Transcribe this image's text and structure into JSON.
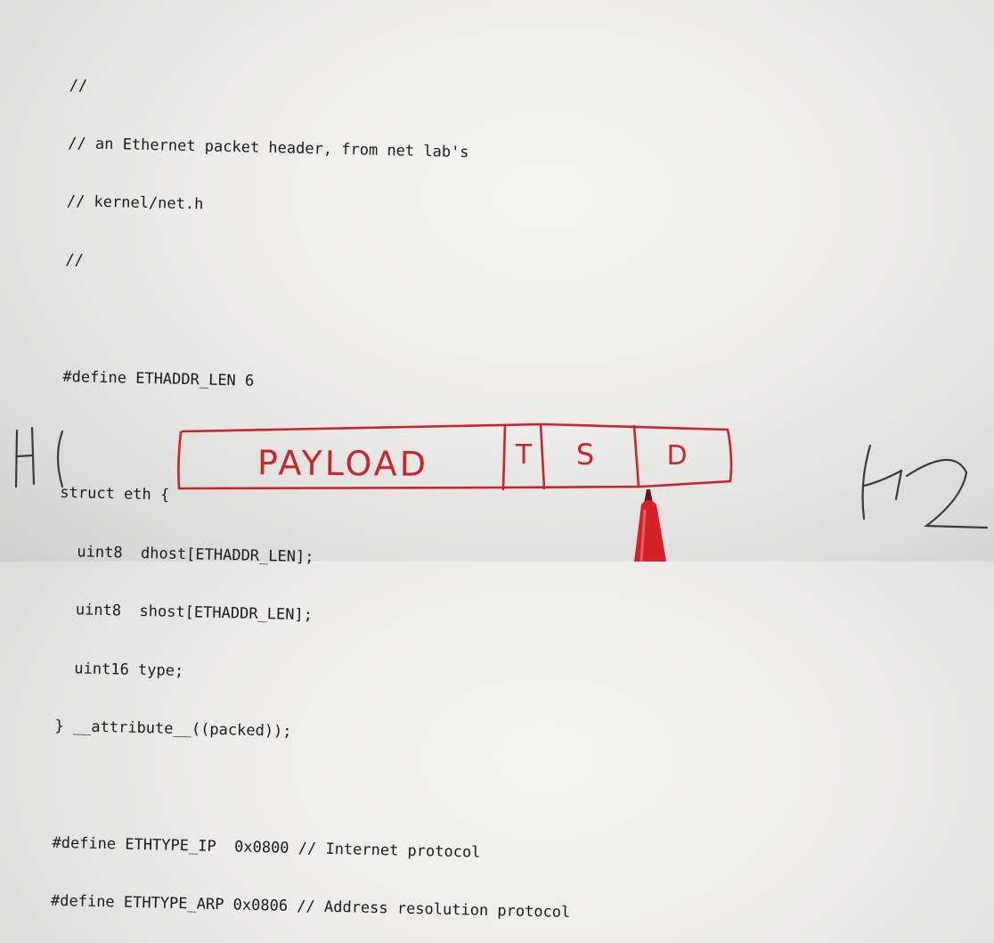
{
  "code": {
    "lines": [
      "//",
      "// an Ethernet packet header, from net lab's",
      "// kernel/net.h",
      "//",
      "",
      "#define ETHADDR_LEN 6",
      "",
      "struct eth {",
      "  uint8  dhost[ETHADDR_LEN];",
      "  uint8  shost[ETHADDR_LEN];",
      "  uint16 type;",
      "} __attribute__((packed));",
      "",
      "#define ETHTYPE_IP  0x0800 // Internet protocol",
      "#define ETHTYPE_ARP 0x0806 // Address resolution protocol"
    ]
  },
  "handwriting": {
    "host_left": "H1",
    "host_right": "H2",
    "payload": "PAYLOAD",
    "type_field": "T",
    "source_field": "S",
    "dest_field": "D",
    "ink_color": "#c8262b"
  }
}
